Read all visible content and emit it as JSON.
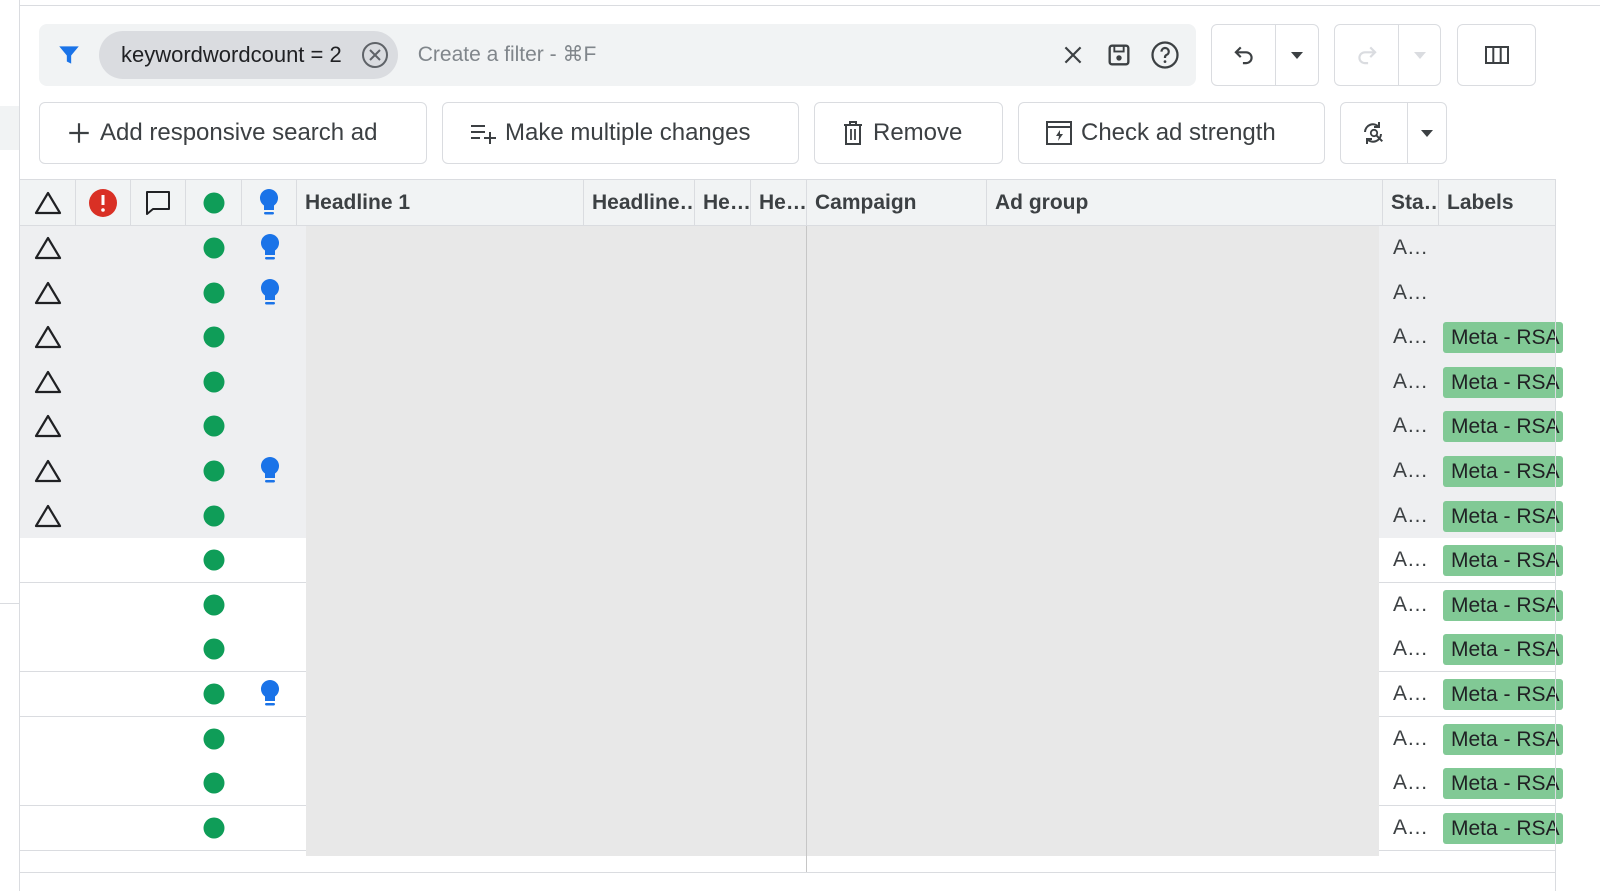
{
  "filter_bar": {
    "chip_label": "keywordwordcount = 2",
    "placeholder": "Create a filter - ⌘F"
  },
  "actions": {
    "add_rsa": "Add responsive search ad",
    "multiple_changes": "Make multiple changes",
    "remove": "Remove",
    "check_strength": "Check ad strength"
  },
  "table": {
    "headers": {
      "headline1": "Headline 1",
      "headline2": "Headline…",
      "headline3": "He…",
      "headline4": "He…",
      "campaign": "Campaign",
      "ad_group": "Ad group",
      "status": "Sta…",
      "labels": "Labels"
    },
    "rows": [
      {
        "warning": true,
        "enabled": true,
        "idea": true,
        "status": "A…",
        "label": ""
      },
      {
        "warning": true,
        "enabled": true,
        "idea": true,
        "status": "A…",
        "label": ""
      },
      {
        "warning": true,
        "enabled": true,
        "idea": false,
        "status": "A…",
        "label": "Meta - RSA"
      },
      {
        "warning": true,
        "enabled": true,
        "idea": false,
        "status": "A…",
        "label": "Meta - RSA"
      },
      {
        "warning": true,
        "enabled": true,
        "idea": false,
        "status": "A…",
        "label": "Meta - RSA"
      },
      {
        "warning": true,
        "enabled": true,
        "idea": true,
        "status": "A…",
        "label": "Meta - RSA"
      },
      {
        "warning": true,
        "enabled": true,
        "idea": false,
        "status": "A…",
        "label": "Meta - RSA"
      },
      {
        "warning": false,
        "enabled": true,
        "idea": false,
        "status": "A…",
        "label": "Meta - RSA"
      },
      {
        "warning": false,
        "enabled": true,
        "idea": false,
        "status": "A…",
        "label": "Meta - RSA"
      },
      {
        "warning": false,
        "enabled": true,
        "idea": false,
        "status": "A…",
        "label": "Meta - RSA"
      },
      {
        "warning": false,
        "enabled": true,
        "idea": true,
        "status": "A…",
        "label": "Meta - RSA"
      },
      {
        "warning": false,
        "enabled": true,
        "idea": false,
        "status": "A…",
        "label": "Meta - RSA"
      },
      {
        "warning": false,
        "enabled": true,
        "idea": false,
        "status": "A…",
        "label": "Meta - RSA"
      },
      {
        "warning": false,
        "enabled": true,
        "idea": false,
        "status": "A…",
        "label": "Meta - RSA"
      }
    ]
  },
  "colors": {
    "accent_blue": "#1a73e8",
    "status_green": "#0f9d58",
    "error_red": "#d93025",
    "label_green": "#81c995"
  },
  "icons": {
    "filter": "filter-icon",
    "chip_remove": "circle-x-icon",
    "clear": "close-icon",
    "save": "save-icon",
    "help": "help-icon",
    "undo": "undo-icon",
    "redo": "redo-icon",
    "columns": "columns-icon",
    "refresh": "refresh-search-icon"
  }
}
